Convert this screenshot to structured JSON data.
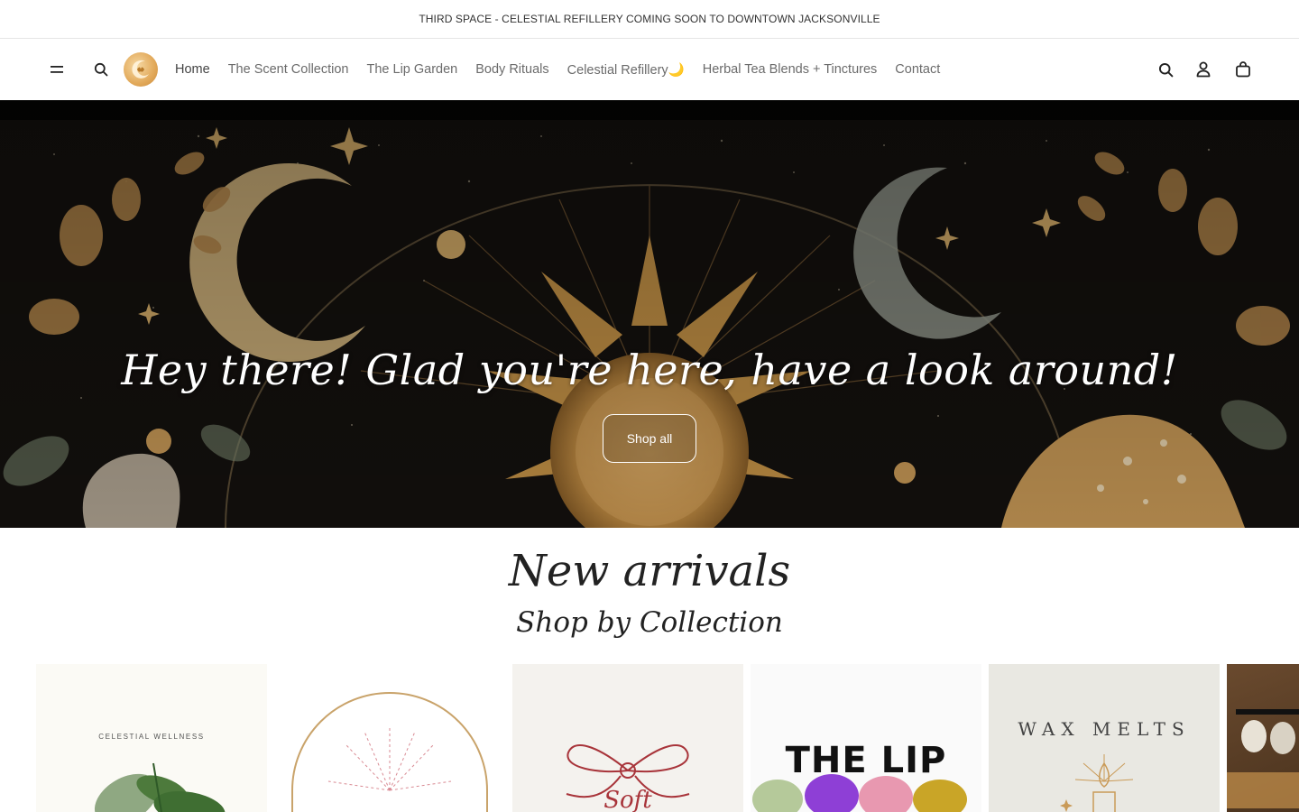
{
  "announcement": {
    "text": "THIRD SPACE - CELESTIAL REFILLERY COMING SOON TO DOWNTOWN JACKSONVILLE"
  },
  "header": {
    "menu_icon": "menu-icon",
    "search_icon": "search-icon",
    "account_icon": "account-icon",
    "cart_icon": "cart-icon",
    "nav": [
      {
        "label": "Home"
      },
      {
        "label": "The Scent Collection"
      },
      {
        "label": "The Lip Garden"
      },
      {
        "label": "Body Rituals"
      },
      {
        "label": "Celestial Refillery🌙"
      },
      {
        "label": "Herbal Tea Blends + Tinctures"
      },
      {
        "label": "Contact"
      }
    ]
  },
  "hero": {
    "title": "Hey there! Glad you're here, have a look around!",
    "button_label": "Shop all"
  },
  "sections": {
    "new_arrivals": "New arrivals",
    "shop_by_collection": "Shop by Collection"
  },
  "collections": [
    {
      "label": "CELESTIAL WELLNESS"
    },
    {
      "label": ""
    },
    {
      "label": "Soft"
    },
    {
      "label": "THE LIP"
    },
    {
      "label": "WAX MELTS"
    },
    {
      "label": ""
    }
  ],
  "colors": {
    "gold": "#c99a4a",
    "hero_bg": "#0f0d0b",
    "nav_text": "#6b6b6b"
  }
}
